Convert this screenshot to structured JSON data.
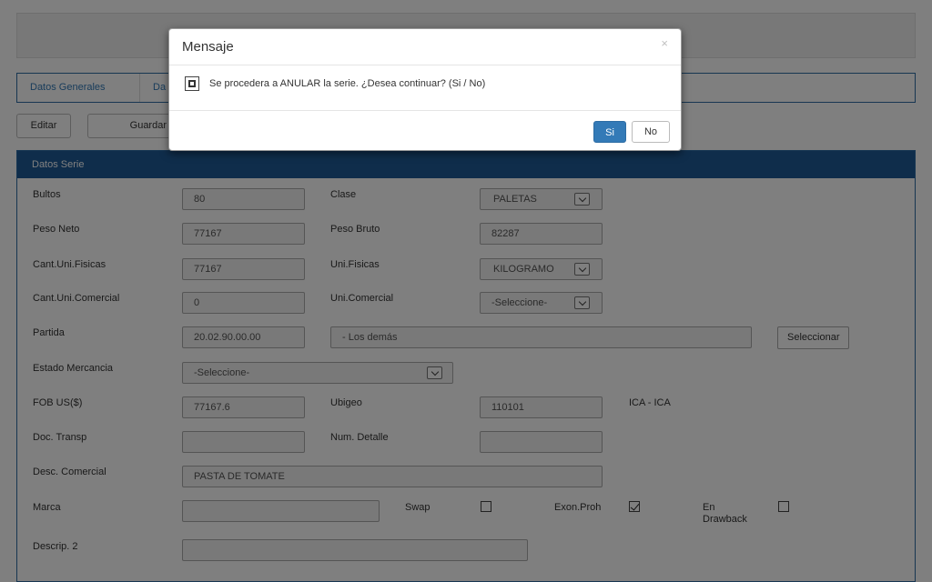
{
  "tabs": {
    "datos_generales": "Datos Generales",
    "second_partial": "Da"
  },
  "toolbar": {
    "edit_label": "Editar",
    "save_label": "Guardar"
  },
  "panel": {
    "title": "Datos Serie"
  },
  "form": {
    "bultos": {
      "label": "Bultos",
      "value": "80"
    },
    "clase": {
      "label": "Clase",
      "value": "PALETAS"
    },
    "peso_neto": {
      "label": "Peso Neto",
      "value": "77167"
    },
    "peso_bruto": {
      "label": "Peso Bruto",
      "value": "82287"
    },
    "cant_uni_fisicas": {
      "label": "Cant.Uni.Fisicas",
      "value": "77167"
    },
    "uni_fisicas": {
      "label": "Uni.Fisicas",
      "value": "KILOGRAMO"
    },
    "cant_uni_comercial": {
      "label": "Cant.Uni.Comercial",
      "value": "0"
    },
    "uni_comercial": {
      "label": "Uni.Comercial",
      "value": "-Seleccione-"
    },
    "partida": {
      "label": "Partida",
      "value": "20.02.90.00.00",
      "desc": "- Los demás",
      "button": "Seleccionar"
    },
    "estado_mercancia": {
      "label": "Estado Mercancia",
      "value": "-Seleccione-"
    },
    "fob": {
      "label": "FOB US($)",
      "value": "77167.6"
    },
    "ubigeo": {
      "label": "Ubigeo",
      "value": "110101",
      "text": "ICA - ICA"
    },
    "doc_transp": {
      "label": "Doc. Transp",
      "value": ""
    },
    "num_detalle": {
      "label": "Num. Detalle",
      "value": ""
    },
    "desc_comercial": {
      "label": "Desc. Comercial",
      "value": "PASTA DE TOMATE"
    },
    "marca": {
      "label": "Marca",
      "value": ""
    },
    "swap": {
      "label": "Swap",
      "checked": false
    },
    "exon_proh": {
      "label": "Exon.Proh",
      "checked": true
    },
    "en_drawback": {
      "label_line1": "En",
      "label_line2": "Drawback",
      "checked": false
    },
    "descrip2": {
      "label": "Descrip. 2",
      "value": ""
    }
  },
  "modal": {
    "title": "Mensaje",
    "close": "×",
    "message": "Se procedera a ANULAR la serie. ¿Desea continuar? (Si / No)",
    "yes_label": "Si",
    "no_label": "No"
  }
}
